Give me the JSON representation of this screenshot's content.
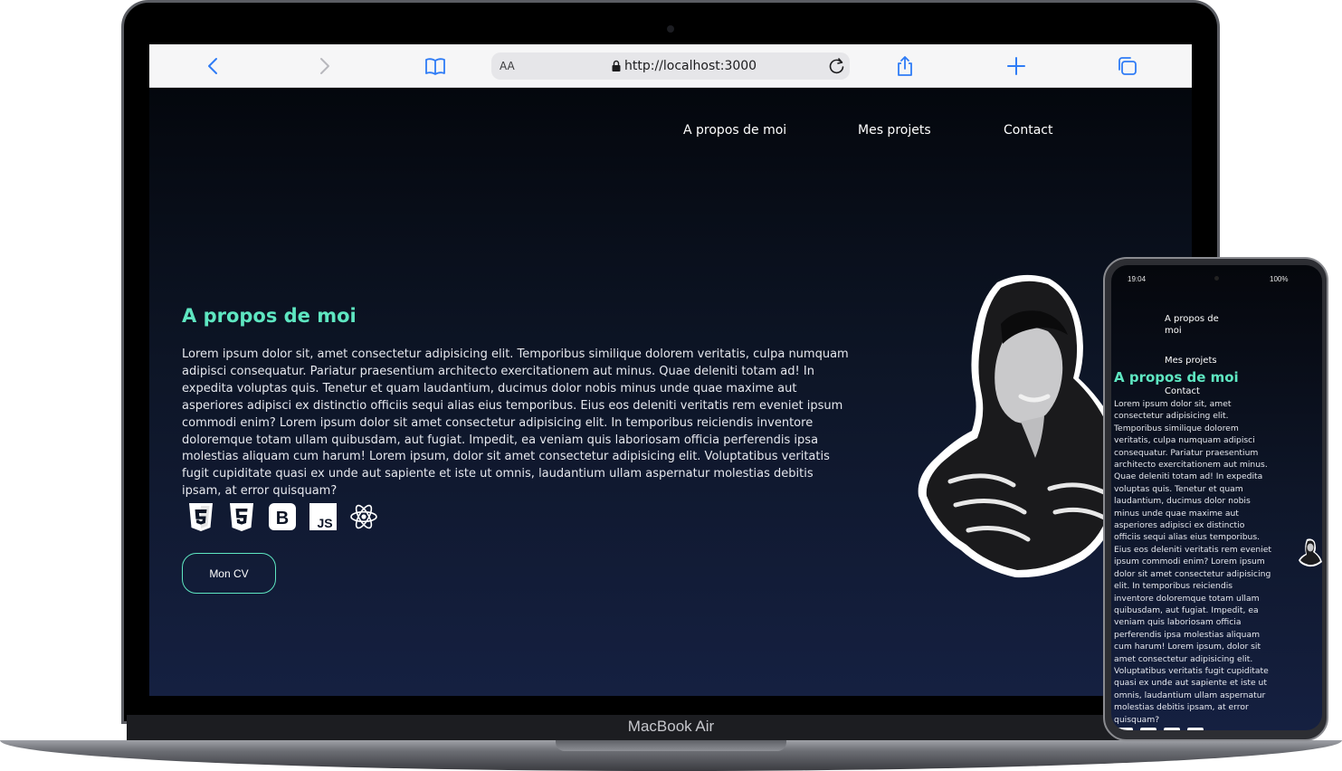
{
  "browser": {
    "reader_label": "AA",
    "url": "http://localhost:3000",
    "icons": [
      "back-icon",
      "forward-icon",
      "bookmarks-icon",
      "lock-icon",
      "reload-icon",
      "share-icon",
      "new-tab-icon",
      "tabs-icon"
    ]
  },
  "site": {
    "nav": [
      "A propos de moi",
      "Mes projets",
      "Contact"
    ],
    "about_title": "A propos de moi",
    "about_text": "Lorem ipsum dolor sit, amet consectetur adipisicing elit. Temporibus similique dolorem veritatis, culpa numquam adipisci consequatur. Pariatur praesentium architecto exercitationem aut minus. Quae deleniti totam ad! In expedita voluptas quis. Tenetur et quam laudantium, ducimus dolor nobis minus unde quae maxime aut asperiores adipisci ex distinctio officiis sequi alias eius temporibus. Eius eos deleniti veritatis rem eveniet ipsum commodi enim? Lorem ipsum dolor sit amet consectetur adipisicing elit. In temporibus reiciendis inventore doloremque totam ullam quibusdam, aut fugiat. Impedit, ea veniam quis laboriosam officia perferendis ipsa molestias aliquam cum harum! Lorem ipsum, dolor sit amet consectetur adipisicing elit. Voluptatibus veritatis fugit cupiditate quasi ex unde aut sapiente et iste ut omnis, laudantium ullam aspernatur molestias debitis ipsam, at error quisquam?",
    "tech_icons": [
      "css3-icon",
      "html5-icon",
      "bootstrap-icon",
      "javascript-icon",
      "react-icon"
    ],
    "tech_labels": {
      "bootstrap": "B",
      "js": "JS"
    },
    "cv_button": "Mon CV",
    "accent_color": "#5ee6c1"
  },
  "laptop": {
    "label": "MacBook Air"
  },
  "phone": {
    "time": "19:04",
    "battery": "100%",
    "nav": [
      "A propos de",
      "moi",
      "Mes projets",
      "Contact"
    ],
    "about_title": "A propos de moi"
  }
}
